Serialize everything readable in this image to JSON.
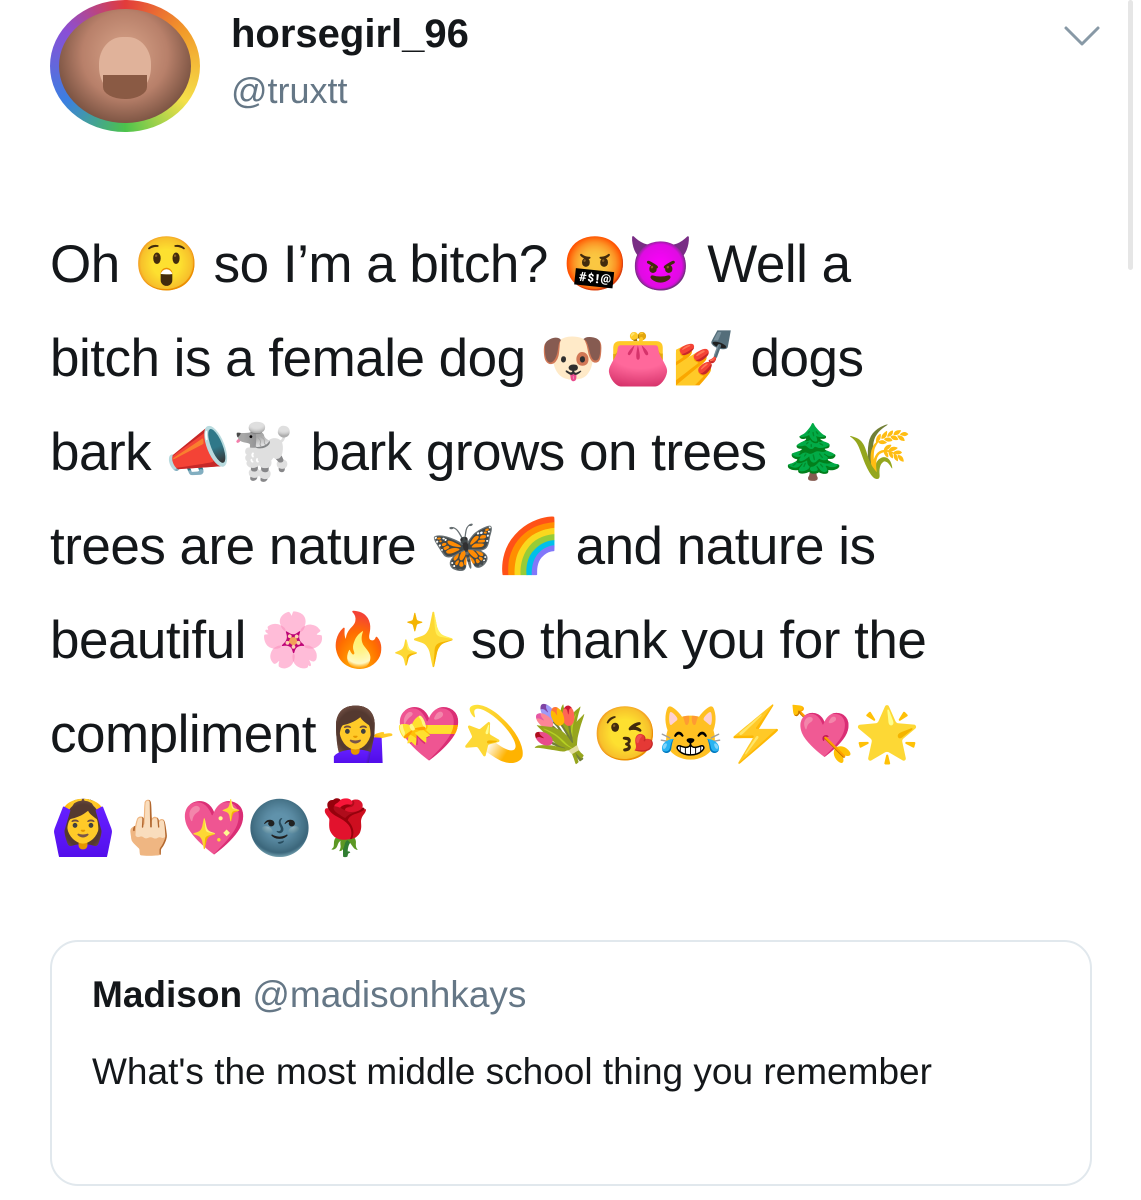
{
  "author": {
    "display_name": "horsegirl_96",
    "handle": "@truxtt",
    "avatar_icon": "avatar-photo"
  },
  "menu_icon": "chevron-down-icon",
  "tweet": {
    "lines": [
      "Oh 😲 so I’m a bitch? 🤬😈 Well a",
      "bitch is a female dog 🐶👛💅 dogs",
      "bark 📣🐩 bark grows on trees 🌲🌾",
      "trees are nature 🦋🌈 and nature is",
      "beautiful 🌸🔥✨ so thank you for the",
      "compliment 💁‍♀️💝💫💐😘😹⚡💘🌟",
      "🙆‍♀️🖕🏻💖🌚🌹"
    ]
  },
  "quoted_tweet": {
    "name": "Madison",
    "handle": "@madisonhkays",
    "text": "What's the most middle school thing you remember"
  },
  "colors": {
    "text": "#14171a",
    "secondary": "#657786",
    "border": "#e1e8ed"
  }
}
